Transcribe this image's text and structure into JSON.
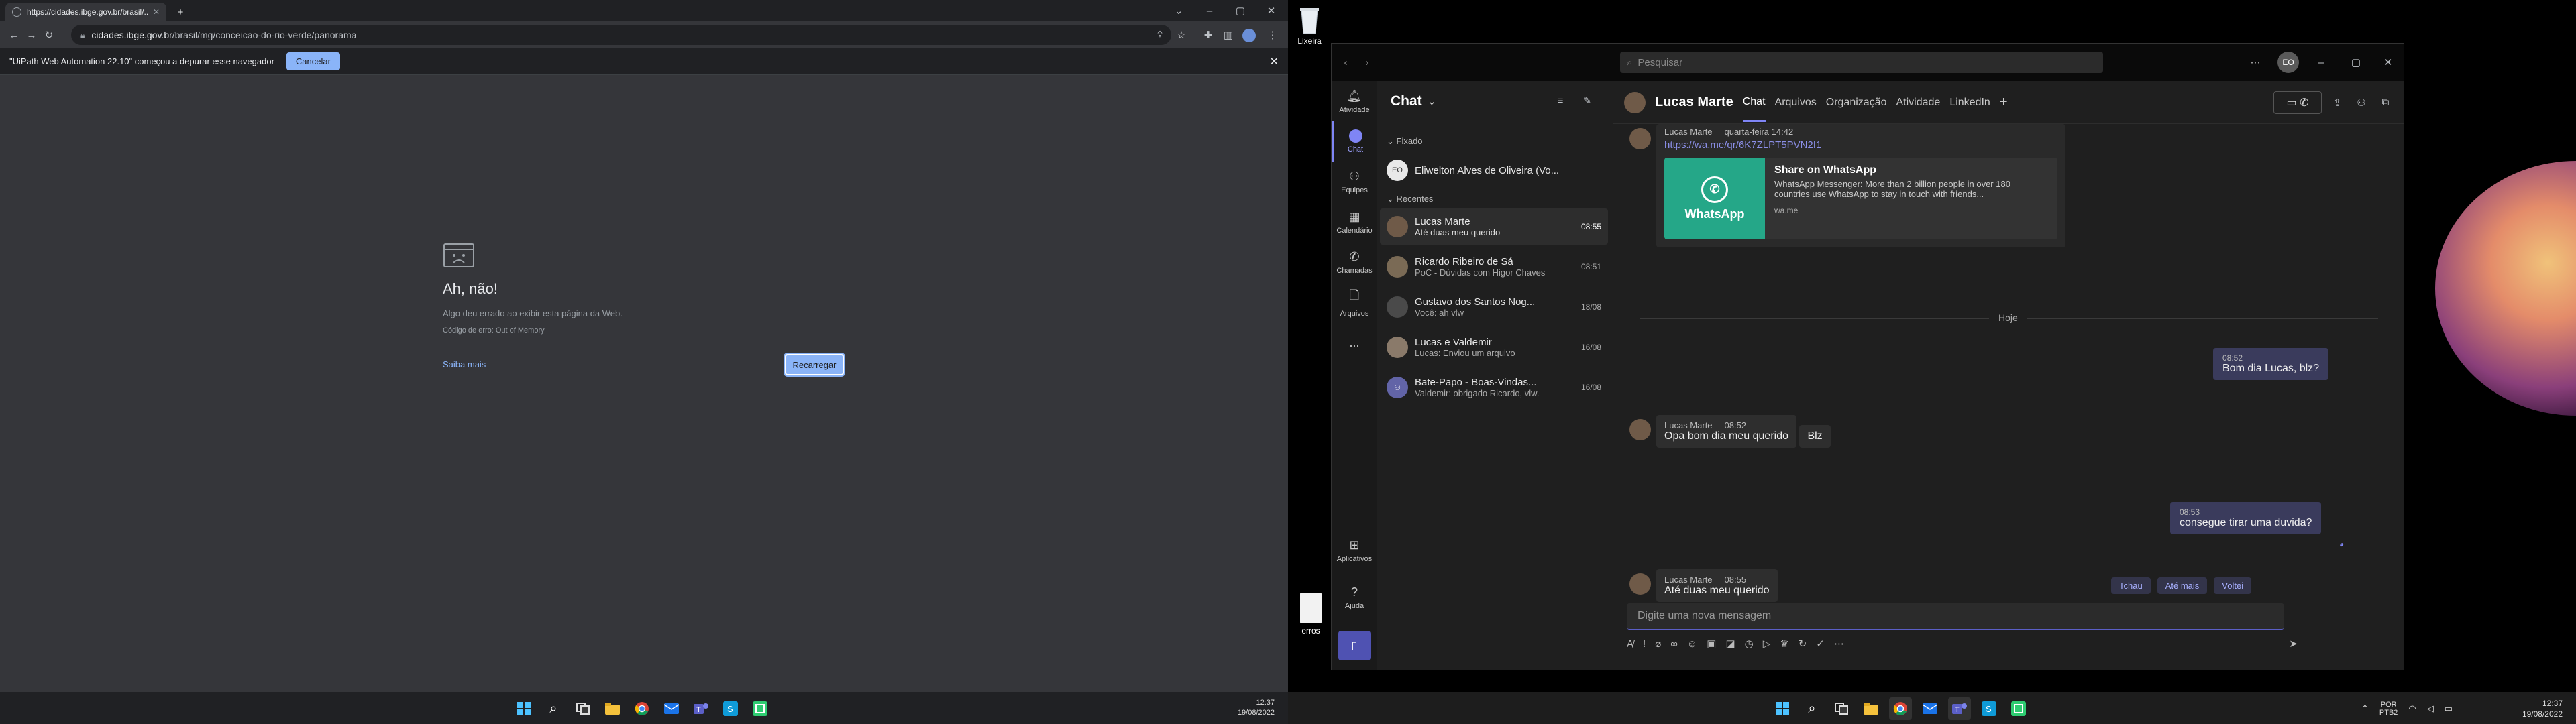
{
  "browser": {
    "tab_title": "https://cidades.ibge.gov.br/brasil/...",
    "url_domain": "cidades.ibge.gov.br",
    "url_path": "/brasil/mg/conceicao-do-rio-verde/panorama",
    "infobar_text": "\"UiPath Web Automation 22.10\" começou a depurar esse navegador",
    "infobar_cancel": "Cancelar",
    "error_title": "Ah, não!",
    "error_message": "Algo deu errado ao exibir esta página da Web.",
    "error_code": "Código de erro: Out of Memory",
    "learn_more": "Saiba mais",
    "reload": "Recarregar"
  },
  "taskbar1": {
    "time": "12:37",
    "date": "19/08/2022"
  },
  "desktop2": {
    "recycle_label": "Lixeira",
    "file_label": "erros"
  },
  "taskbar2": {
    "lang": "POR",
    "lang2": "PTB2",
    "time": "12:37",
    "date": "19/08/2022"
  },
  "teams": {
    "search_placeholder": "Pesquisar",
    "profile_initials": "EO",
    "rail": [
      "Atividade",
      "Chat",
      "Equipes",
      "Calendário",
      "Chamadas",
      "Arquivos",
      "...",
      "Aplicativos",
      "Ajuda"
    ],
    "list_title": "Chat",
    "pinned_label": "Fixado",
    "recent_label": "Recentes",
    "pinned": [
      {
        "name": "Eliwelton Alves de Oliveira (Vo...",
        "initials": "EO"
      }
    ],
    "chats": [
      {
        "name": "Lucas Marte",
        "preview": "Até duas meu querido",
        "time": "08:55",
        "active": true
      },
      {
        "name": "Ricardo Ribeiro de Sá",
        "preview": "PoC - Dúvidas com Higor Chaves",
        "time": "08:51"
      },
      {
        "name": "Gustavo dos Santos Nog...",
        "preview": "Você: ah vlw",
        "time": "18/08"
      },
      {
        "name": "Lucas e Valdemir",
        "preview": "Lucas: Enviou um arquivo",
        "time": "16/08"
      },
      {
        "name": "Bate-Papo - Boas-Vindas...",
        "preview": "Valdemir: obrigado Ricardo, vlw.",
        "time": "16/08"
      }
    ],
    "chat_name": "Lucas Marte",
    "tabs": [
      "Chat",
      "Arquivos",
      "Organização",
      "Atividade",
      "LinkedIn"
    ],
    "messages": {
      "m0_author": "Lucas Marte",
      "m0_time": "quarta-feira 14:42",
      "m0_link": "https://wa.me/qr/6K7ZLPT5PVN2I1",
      "card_title": "Share on WhatsApp",
      "card_desc": "WhatsApp Messenger: More than 2 billion people in over 180 countries use WhatsApp to stay in touch with friends...",
      "card_domain": "wa.me",
      "card_logo": "WhatsApp",
      "divider": "Hoje",
      "me1_time": "08:52",
      "me1_text": "Bom dia Lucas, blz?",
      "m2_author": "Lucas Marte",
      "m2_time": "08:52",
      "m2_text": "Opa bom dia meu querido",
      "m3_text": "Blz",
      "me2_time": "08:53",
      "me2_text": "consegue tirar uma duvida?",
      "m4_author": "Lucas Marte",
      "m4_time": "08:55",
      "m4_text": "Até duas meu querido"
    },
    "suggestions": [
      "Tchau",
      "Até mais",
      "Voltei"
    ],
    "compose_placeholder": "Digite uma nova mensagem"
  }
}
